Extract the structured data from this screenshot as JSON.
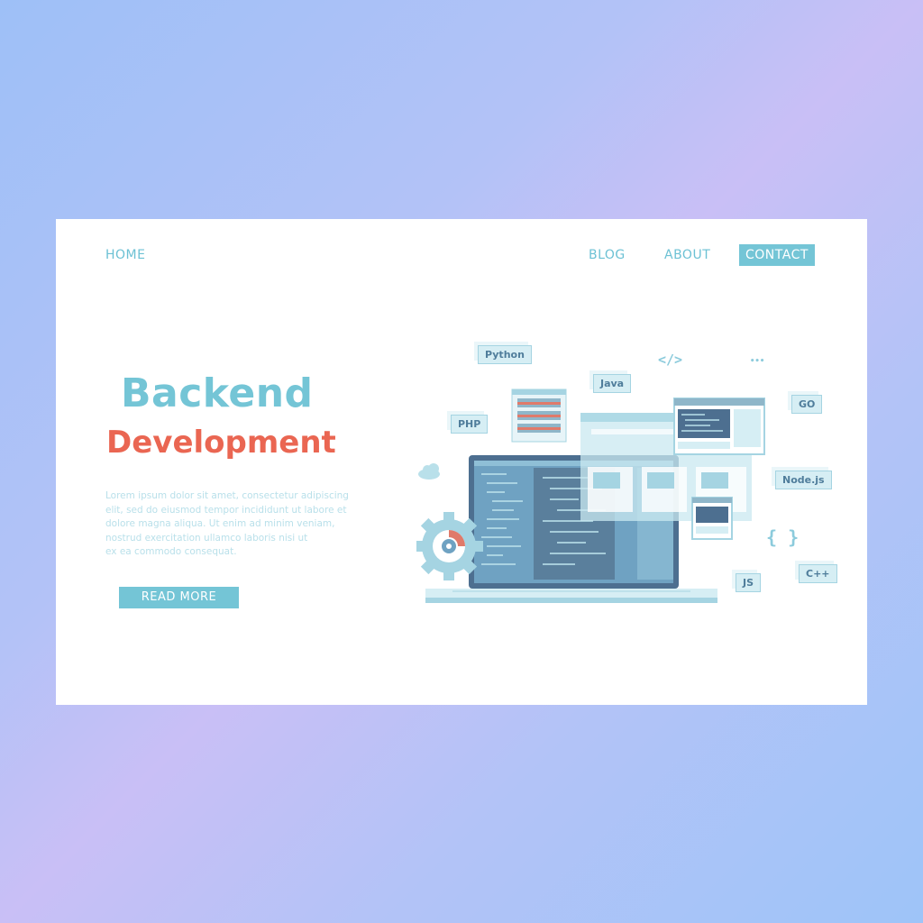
{
  "nav": {
    "home": "HOME",
    "blog": "BLOG",
    "about": "ABOUT",
    "contact": "CONTACT"
  },
  "hero": {
    "title_line1": "Backend",
    "title_line2": "Development",
    "lorem_lines": [
      "Lorem ipsum dolor sit amet, consectetur adipiscing",
      "elit, sed do eiusmod tempor incididunt ut labore et",
      "dolore magna aliqua. Ut enim ad minim veniam,",
      "nostrud exercitation ullamco laboris nisi ut",
      "ex ea commodo consequat."
    ],
    "read_more": "READ MORE"
  },
  "tech_tags": {
    "python": "Python",
    "java": "Java",
    "php": "PHP",
    "go": "GO",
    "nodejs": "Node.js",
    "cpp": "C++",
    "js": "JS"
  },
  "symbols": {
    "code_tag": "</>",
    "dots": "•••",
    "braces": "{ }"
  },
  "colors": {
    "accent": "#74c5d6",
    "brand_red": "#ea6652",
    "text_light": "#b9e0ea"
  },
  "icons": [
    "cloud-icon",
    "gear-icon",
    "laptop-icon",
    "server-icon",
    "browser-window-icon"
  ]
}
